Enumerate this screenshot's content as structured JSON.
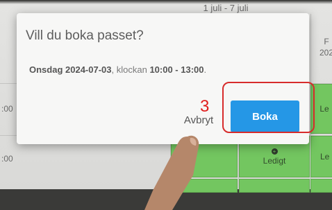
{
  "calendar": {
    "week_range": "1 juli - 7 juli",
    "day_header_partial_1": "F",
    "day_header_partial_2": "202",
    "time_labels": [
      ":00",
      ":00"
    ],
    "slot_label": "Ledigt",
    "slot_label_partial": "Le"
  },
  "dialog": {
    "title": "Vill du boka passet?",
    "date_bold": "Onsdag 2024-07-03",
    "middle_text": ", klockan ",
    "time_bold": "10:00 - 13:00",
    "end_text": ".",
    "cancel_label": "Avbryt",
    "book_label": "Boka"
  },
  "annotation": {
    "step_number": "3",
    "color": "#d72b2b"
  },
  "colors": {
    "slot_green": "#73c660",
    "primary_blue": "#2597e6"
  },
  "icons": {
    "slot_icon": "plus-circle-icon"
  }
}
